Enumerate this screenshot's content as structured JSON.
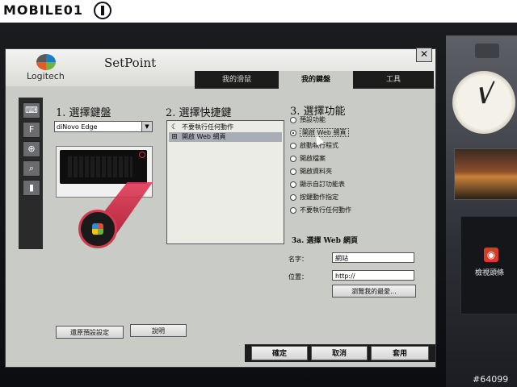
{
  "banner": {
    "brand": "MOBILE01"
  },
  "watermark": "#64099",
  "window": {
    "logo_text": "Logitech",
    "title": "SetPoint",
    "close_symbol": "✕",
    "tabs": [
      {
        "label": "我的滑鼠",
        "active": false
      },
      {
        "label": "我的鍵盤",
        "active": true
      },
      {
        "label": "工具",
        "active": false
      }
    ]
  },
  "sidebar": {
    "icons": [
      "keyboard-icon",
      "f-key-icon",
      "zoom-icon",
      "search-icon",
      "battery-icon"
    ]
  },
  "section1": {
    "heading": "1. 選擇鍵盤",
    "selected_keyboard": "diNovo Edge"
  },
  "section2": {
    "heading": "2. 選擇快捷鍵",
    "items": [
      {
        "label": "不要執行任何動作",
        "icon": "moon-icon",
        "selected": false
      },
      {
        "label": "開啟 Web 網頁",
        "icon": "windows-icon",
        "selected": true
      }
    ]
  },
  "section3": {
    "heading": "3. 選擇功能",
    "options": [
      {
        "label": "預設功能",
        "checked": false
      },
      {
        "label": "開啟 Web 網頁",
        "checked": true
      },
      {
        "label": "啟動執行程式",
        "checked": false
      },
      {
        "label": "開啟檔案",
        "checked": false
      },
      {
        "label": "開啟資料夾",
        "checked": false
      },
      {
        "label": "顯示自訂功能表",
        "checked": false
      },
      {
        "label": "按鍵動作指定",
        "checked": false
      },
      {
        "label": "不要執行任何動作",
        "checked": false
      }
    ],
    "subheading": "3a. 選擇 Web 網頁",
    "name_label": "名字：",
    "name_value": "網站",
    "location_label": "位置：",
    "location_value": "http://",
    "browse_label": "瀏覽我的最愛..."
  },
  "footer": {
    "restore_defaults": "還原預設設定",
    "help": "說明",
    "ok": "確定",
    "cancel": "取消",
    "apply": "套用"
  },
  "desktop": {
    "feed_label": "檢視頭條"
  },
  "colors": {
    "window_bg": "#c9cbc6",
    "tab_bar": "#1c1c1c",
    "accent_red": "#d23b4e"
  }
}
